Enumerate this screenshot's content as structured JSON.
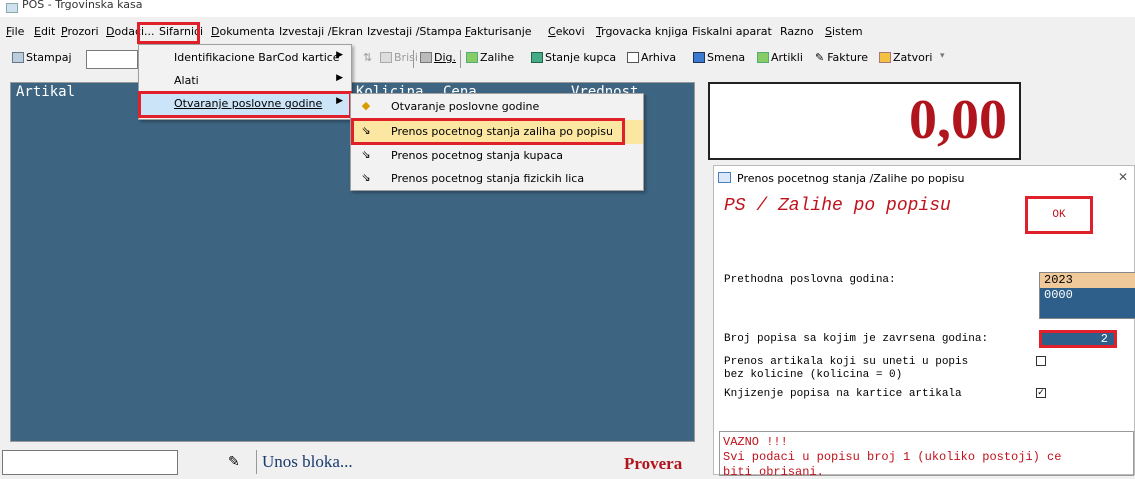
{
  "window": {
    "title": "POS - Trgovinska kasa"
  },
  "menubar": {
    "items": [
      {
        "label": "File",
        "u": "F",
        "rest": "ile"
      },
      {
        "label": "Edit",
        "u": "E",
        "rest": "dit"
      },
      {
        "label": "Prozori",
        "u": "P",
        "rest": "rozori"
      },
      {
        "label": "Dodaci...",
        "u": "D",
        "rest": "odaci..."
      },
      {
        "label": "Sifarnici",
        "u": "",
        "rest": "Sifarnici"
      },
      {
        "label": "Dokumenta",
        "u": "D",
        "rest": "okumenta"
      },
      {
        "label": "Izvestaji /Ekran",
        "u": "",
        "rest": "Izvestaji /Ekran"
      },
      {
        "label": "Izvestaji /Stampa",
        "u": "",
        "rest": "Izvestaji /Stampa"
      },
      {
        "label": "Fakturisanje",
        "u": "F",
        "rest": "akturisanje"
      },
      {
        "label": "Cekovi",
        "u": "C",
        "rest": "ekovi"
      },
      {
        "label": "Trgovacka knjiga",
        "u": "T",
        "rest": "rgovacka knjiga"
      },
      {
        "label": "Fiskalni aparat",
        "u": "",
        "rest": "Fiskalni aparat"
      },
      {
        "label": "Razno",
        "u": "",
        "rest": "Razno"
      },
      {
        "label": "Sistem",
        "u": "S",
        "rest": "istem"
      }
    ]
  },
  "toolbar": {
    "stampaj": "Stampaj",
    "sort_icon": "sort-icon",
    "brisi": "Brisi",
    "dig": "Dig.",
    "zalihe": "Zalihe",
    "stanje_kupca": "Stanje kupca",
    "arhiva": "Arhiva",
    "smena": "Smena",
    "artikli": "Artikli",
    "fakture": "Fakture",
    "zatvori": "Zatvori"
  },
  "dropdown": {
    "items": [
      {
        "label": "Identifikacione BarCod kartice",
        "has_sub": true
      },
      {
        "label": "Alati",
        "has_sub": true
      },
      {
        "label": "Otvaranje poslovne godine",
        "has_sub": true
      }
    ]
  },
  "submenu": {
    "items": [
      {
        "label": "Otvaranje poslovne godine",
        "icon": "warning-diamond-icon"
      },
      {
        "label": "Prenos pocetnog stanja zaliha po popisu",
        "icon": "transfer-icon"
      },
      {
        "label": "Prenos pocetnog stanja kupaca",
        "icon": "transfer-icon"
      },
      {
        "label": "Prenos pocetnog stanja fizickih lica",
        "icon": "transfer-icon"
      }
    ]
  },
  "grid": {
    "columns": [
      "Artikal",
      "Kolicina",
      "Cena",
      "Vrednost"
    ]
  },
  "total": {
    "value": "0,00"
  },
  "dialog": {
    "title": "Prenos pocetnog stanja /Zalihe po popisu",
    "heading": "PS / Zalihe po popisu",
    "ok_label": "OK",
    "prev_year_label": "Prethodna poslovna godina:",
    "years": [
      "2023",
      "0000"
    ],
    "broj_label": "Broj popisa sa kojim je zavrsena godina:",
    "broj_value": "2",
    "prenos_label_1": "Prenos artikala koji su uneti u popis",
    "prenos_label_2": "bez kolicine (kolicina = 0)",
    "prenos_checked": false,
    "knjizenje_label": "Knjizenje popisa na kartice artikala",
    "knjizenje_checked": true,
    "warning_title": "VAZNO !!!",
    "warning_line1": "Svi podaci u popisu broj 1 (ukoliko postoji) ce",
    "warning_line2": "biti obrisani."
  },
  "statusbar": {
    "unos": "Unos bloka...",
    "provera": "Provera"
  },
  "colors": {
    "accent_red": "#e0202a",
    "grid_blue": "#3d6582",
    "total_red": "#b0141c"
  }
}
